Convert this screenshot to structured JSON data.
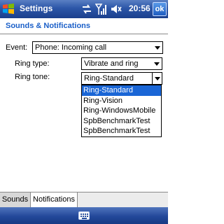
{
  "titlebar": {
    "title": "Settings",
    "time": "20:56",
    "ok_label": "ok",
    "icons": [
      "start-icon",
      "sync-icon",
      "signal-icon",
      "volume-icon"
    ]
  },
  "section": {
    "title": "Sounds & Notifications"
  },
  "form": {
    "event_label": "Event:",
    "event_value": "Phone: Incoming call",
    "ring_type_label": "Ring type:",
    "ring_type_value": "Vibrate and ring",
    "ring_tone_label": "Ring tone:",
    "ring_tone_value": "Ring-Standard"
  },
  "ring_tone_options": [
    {
      "label": "Ring-Standard",
      "selected": true
    },
    {
      "label": "Ring-Vision",
      "selected": false
    },
    {
      "label": "Ring-WindowsMobile",
      "selected": false
    },
    {
      "label": "SpbBenchmarkTest",
      "selected": false
    },
    {
      "label": "SpbBenchmarkTest",
      "selected": false
    }
  ],
  "tabs": [
    {
      "label": "Sounds",
      "active": false
    },
    {
      "label": "Notifications",
      "active": true
    }
  ],
  "softbar": {
    "icon": "keyboard-icon"
  },
  "colors": {
    "accent": "#1a5fc8",
    "selection": "#1a66d6",
    "titlebar": "#2c56a8"
  }
}
